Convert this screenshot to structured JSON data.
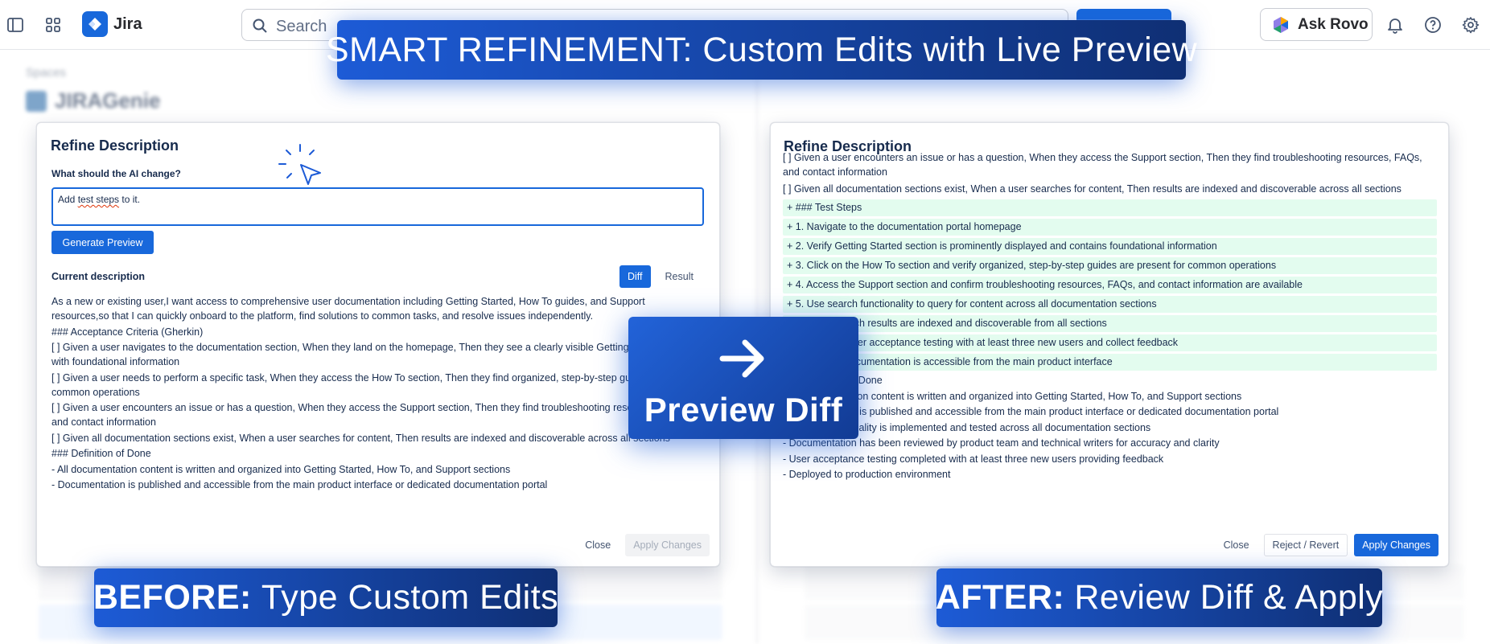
{
  "topbar": {
    "app_name": "Jira",
    "search_placeholder": "Search",
    "create_label": "",
    "rovo_label": "Ask Rovo"
  },
  "background": {
    "breadcrumb": "Spaces",
    "project_name": "JIRAGenie"
  },
  "overlays": {
    "top_banner": "SMART REFINEMENT: Custom Edits with Live Preview",
    "before_bold": "BEFORE:",
    "before_text": "Type Custom Edits",
    "after_bold": "AFTER:",
    "after_text": "Review Diff & Apply",
    "center_label": "Preview Diff"
  },
  "left_dialog": {
    "title": "Refine Description",
    "prompt_label": "What should the AI change?",
    "input_value_prefix": "Add ",
    "input_value_misspelled": "test steps",
    "input_value_suffix": " to it.",
    "generate_button": "Generate Preview",
    "current_label": "Current description",
    "diff_tab": "Diff",
    "result_tab": "Result",
    "lines": [
      "As a new or existing user,I want access to comprehensive user documentation including Getting Started, How To guides, and Support resources,so that I can quickly onboard to the platform, find solutions to common tasks, and resolve issues independently.",
      "### Acceptance Criteria (Gherkin)",
      "[ ] Given a user navigates to the documentation section, When they land on the homepage, Then they see a clearly visible Getting Started guide with foundational information",
      "[ ] Given a user needs to perform a specific task, When they access the How To section, Then they find organized, step-by-step guides for common operations",
      "[ ] Given a user encounters an issue or has a question, When they access the Support section, Then they find troubleshooting resources, FAQs, and contact information",
      "[ ] Given all documentation sections exist, When a user searches for content, Then results are indexed and discoverable across all sections",
      "### Definition of Done",
      "- All documentation content is written and organized into Getting Started, How To, and Support sections",
      "- Documentation is published and accessible from the main product interface or dedicated documentation portal"
    ],
    "close_button": "Close",
    "apply_button": "Apply Changes"
  },
  "right_dialog": {
    "title": "Refine Description",
    "top_lines": [
      "[ ] Given a user encounters an issue or has a question, When they access the Support section, Then they find troubleshooting resources, FAQs, and contact information",
      "[ ] Given all documentation sections exist, When a user searches for content, Then results are indexed and discoverable across all sections"
    ],
    "added_lines": [
      "+ ### Test Steps",
      "+ 1. Navigate to the documentation portal homepage",
      "+ 2. Verify Getting Started section is prominently displayed and contains foundational information",
      "+ 3. Click on the How To section and verify organized, step-by-step guides are present for common operations",
      "+ 4. Access the Support section and confirm troubleshooting resources, FAQs, and contact information are available",
      "+ 5. Use search functionality to query for content across all documentation sections",
      "+ 6. Verify search results are indexed and discoverable from all sections",
      "+ 7. Conduct user acceptance testing with at least three new users and collect feedback",
      "+ 8. Confirm documentation is accessible from the main product interface"
    ],
    "rest_lines": [
      "### Definition of Done",
      "- All documentation content is written and organized into Getting Started, How To, and Support sections",
      "- Documentation is published and accessible from the main product interface or dedicated documentation portal",
      "- Search functionality is implemented and tested across all documentation sections",
      "- Documentation has been reviewed by product team and technical writers for accuracy and clarity",
      "- User acceptance testing completed with at least three new users providing feedback",
      "- Deployed to production environment"
    ],
    "close_button": "Close",
    "reject_button": "Reject / Revert",
    "apply_button": "Apply Changes"
  },
  "colors": {
    "accent": "#1868db",
    "added_bg": "#e3fcef",
    "banner_start": "#1d5bd6",
    "banner_end": "#0f2f74"
  }
}
